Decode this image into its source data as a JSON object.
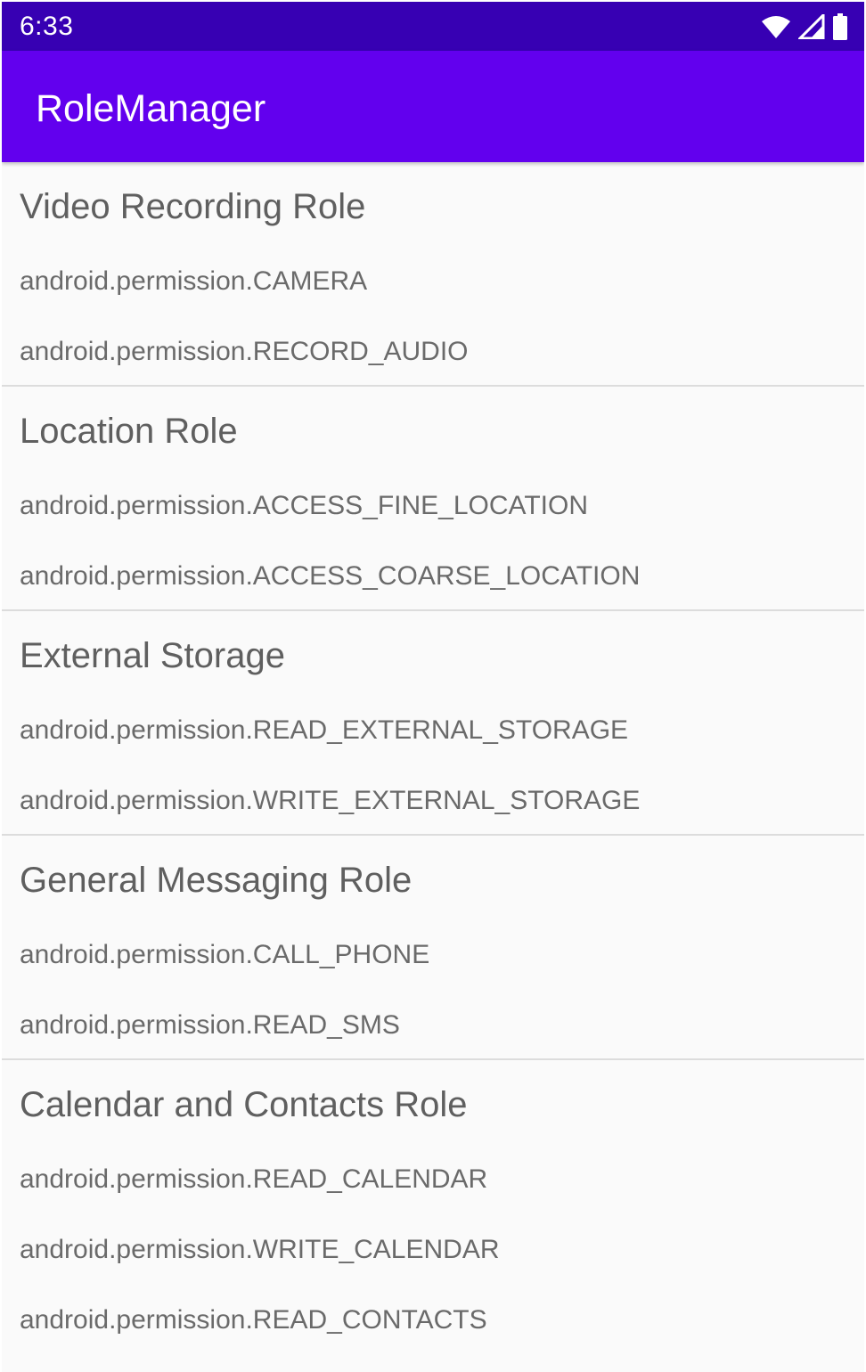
{
  "status_bar": {
    "time": "6:33",
    "icons": [
      "wifi-icon",
      "cell-signal-icon",
      "battery-icon"
    ]
  },
  "app_bar": {
    "title": "RoleManager"
  },
  "colors": {
    "status_bar": "#3700b3",
    "app_bar": "#6200ee",
    "background": "#fafafa",
    "divider": "#dcdcdc",
    "title_text": "#5f5f5f",
    "permission_text": "#6a6a6a"
  },
  "roles": [
    {
      "title": "Video Recording Role",
      "permissions": [
        "android.permission.CAMERA",
        "android.permission.RECORD_AUDIO"
      ]
    },
    {
      "title": "Location Role",
      "permissions": [
        "android.permission.ACCESS_FINE_LOCATION",
        "android.permission.ACCESS_COARSE_LOCATION"
      ]
    },
    {
      "title": "External Storage",
      "permissions": [
        "android.permission.READ_EXTERNAL_STORAGE",
        "android.permission.WRITE_EXTERNAL_STORAGE"
      ]
    },
    {
      "title": "General Messaging Role",
      "permissions": [
        "android.permission.CALL_PHONE",
        "android.permission.READ_SMS"
      ]
    },
    {
      "title": "Calendar and Contacts Role",
      "permissions": [
        "android.permission.READ_CALENDAR",
        "android.permission.WRITE_CALENDAR",
        "android.permission.READ_CONTACTS"
      ]
    }
  ]
}
